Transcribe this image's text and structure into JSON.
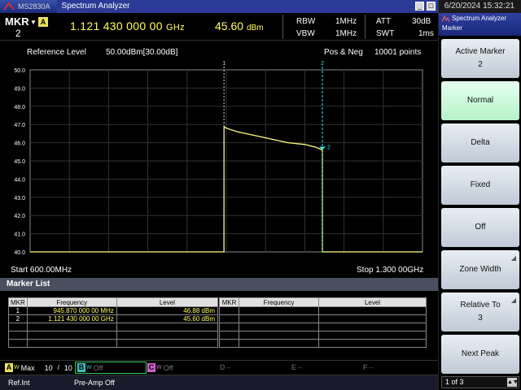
{
  "titlebar": {
    "model": "MS2830A",
    "app_title": "Spectrum Analyzer",
    "datetime": "6/20/2024 15:32:21"
  },
  "header": {
    "marker_label": "MKR",
    "marker_number": "2",
    "active_badge": "A",
    "frequency": "1.121 430 000 00",
    "frequency_unit": "GHz",
    "level": "45.60",
    "level_unit": "dBm",
    "rbw_label": "RBW",
    "rbw_value": "1MHz",
    "vbw_label": "VBW",
    "vbw_value": "1MHz",
    "att_label": "ATT",
    "att_value": "30dB",
    "swt_label": "SWT",
    "swt_value": "1ms"
  },
  "graph": {
    "reference_label": "Reference Level",
    "reference_value": "50.00dBm[30.00dB]",
    "detection": "Pos & Neg",
    "points": "10001 points",
    "y_ticks": [
      "50.0",
      "49.0",
      "48.0",
      "47.0",
      "46.0",
      "45.0",
      "44.0",
      "43.0",
      "42.0",
      "41.0",
      "40.0"
    ],
    "start_label": "Start 600.00MHz",
    "stop_label": "Stop 1.300 00GHz",
    "marker1_tag": "1",
    "marker2_tag": "2",
    "marker2_trace_tag": "2",
    "trace_color": "#ffff80",
    "marker_color": "#40e0e0"
  },
  "chart_data": {
    "type": "line",
    "xlabel": "",
    "ylabel": "",
    "xlim": [
      0.6,
      1.3
    ],
    "ylim": [
      40.0,
      50.0
    ],
    "x_unit": "GHz",
    "y_unit": "dBm",
    "grid": true,
    "series": [
      {
        "x": [
          0.6,
          0.9458,
          0.9459,
          0.95,
          0.97,
          1.0,
          1.03,
          1.06,
          1.09,
          1.11,
          1.1214,
          1.1215,
          1.3
        ],
        "y": [
          40.0,
          40.0,
          46.88,
          46.8,
          46.6,
          46.4,
          46.2,
          46.0,
          45.9,
          45.75,
          45.6,
          40.0,
          40.0
        ]
      }
    ],
    "markers": [
      {
        "label": "1",
        "x": 0.94587,
        "y": 46.88
      },
      {
        "label": "2",
        "x": 1.12143,
        "y": 45.6
      }
    ]
  },
  "marker_list": {
    "title": "Marker List",
    "columns": [
      "MKR",
      "Frequency",
      "Level"
    ],
    "rows": [
      {
        "mkr": "1",
        "frequency": "945.870 000 00 MHz",
        "level": "46.88 dBm"
      },
      {
        "mkr": "2",
        "frequency": "1.121 430 000 00 GHz",
        "level": "45.60 dBm"
      }
    ]
  },
  "traces": {
    "a": {
      "letter": "A",
      "w": "W",
      "mode": "Max",
      "count": "10",
      "sep": "/",
      "total": "10"
    },
    "b": {
      "letter": "B",
      "w": "W",
      "mode": "Off"
    },
    "c": {
      "letter": "C",
      "w": "W",
      "mode": "Off"
    },
    "d": {
      "letter": "D",
      "mode": "–"
    },
    "e": {
      "letter": "E",
      "mode": "–"
    },
    "f": {
      "letter": "F",
      "mode": "–"
    }
  },
  "status": {
    "ref": "Ref.Int",
    "preamp": "Pre-Amp Off"
  },
  "panel": {
    "title": "Spectrum Analyzer",
    "subtitle": "Marker",
    "keys": [
      {
        "label": "Active Marker",
        "sub": "2"
      },
      {
        "label": "Normal",
        "sub": ""
      },
      {
        "label": "Delta",
        "sub": ""
      },
      {
        "label": "Fixed",
        "sub": ""
      },
      {
        "label": "Off",
        "sub": ""
      },
      {
        "label": "Zone Width",
        "sub": ""
      },
      {
        "label": "Relative To",
        "sub": "3"
      },
      {
        "label": "Next Peak",
        "sub": ""
      }
    ],
    "page": "1 of 3"
  }
}
